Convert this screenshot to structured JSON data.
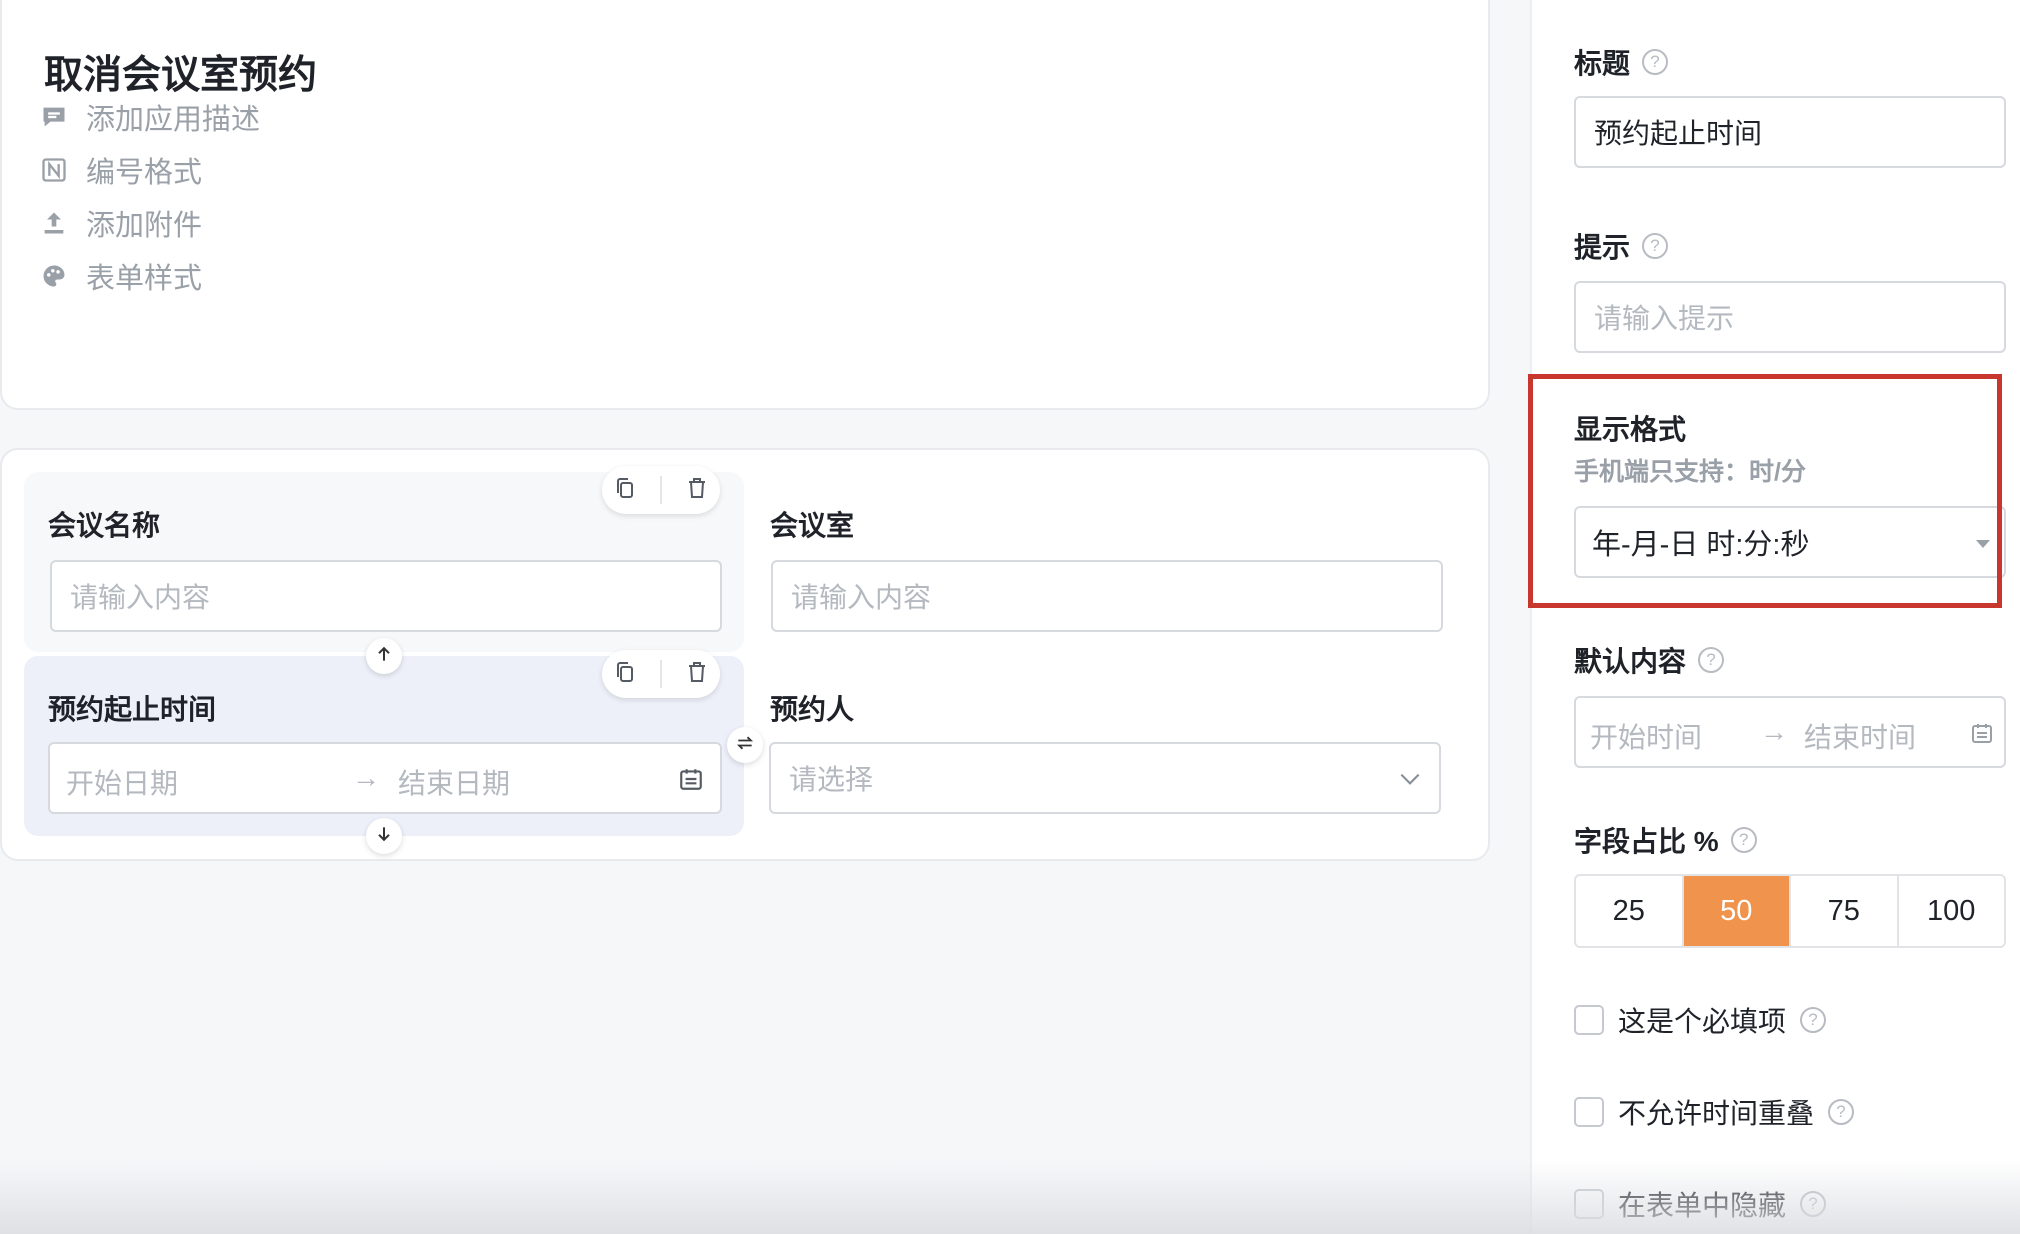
{
  "app": {
    "title": "取消会议室预约",
    "meta": [
      {
        "icon": "comment-icon",
        "label": "添加应用描述"
      },
      {
        "icon": "number-format-icon",
        "label": "编号格式"
      },
      {
        "icon": "upload-icon",
        "label": "添加附件"
      },
      {
        "icon": "palette-icon",
        "label": "表单样式"
      }
    ]
  },
  "form": {
    "meeting_name": {
      "label": "会议名称",
      "placeholder": "请输入内容"
    },
    "meeting_room": {
      "label": "会议室",
      "placeholder": "请输入内容"
    },
    "booking_time": {
      "label": "预约起止时间",
      "start_placeholder": "开始日期",
      "arrow": "→",
      "end_placeholder": "结束日期"
    },
    "booker": {
      "label": "预约人",
      "placeholder": "请选择"
    }
  },
  "panel": {
    "title_label": "标题",
    "title_value": "预约起止时间",
    "hint_label": "提示",
    "hint_placeholder": "请输入提示",
    "format_label": "显示格式",
    "format_sub": "手机端只支持：时/分",
    "format_value": "年-月-日 时:分:秒",
    "default_label": "默认内容",
    "default_start": "开始时间",
    "default_arrow": "→",
    "default_end": "结束时间",
    "ratio_label": "字段占比 %",
    "ratio_options": [
      "25",
      "50",
      "75",
      "100"
    ],
    "ratio_selected": "50",
    "checkboxes": [
      "这是个必填项",
      "不允许时间重叠",
      "在表单中隐藏"
    ],
    "help_glyph": "?"
  },
  "colors": {
    "accent": "#f0944d",
    "highlight_border": "#c8372d",
    "selected_field_bg": "#edf0f9"
  }
}
